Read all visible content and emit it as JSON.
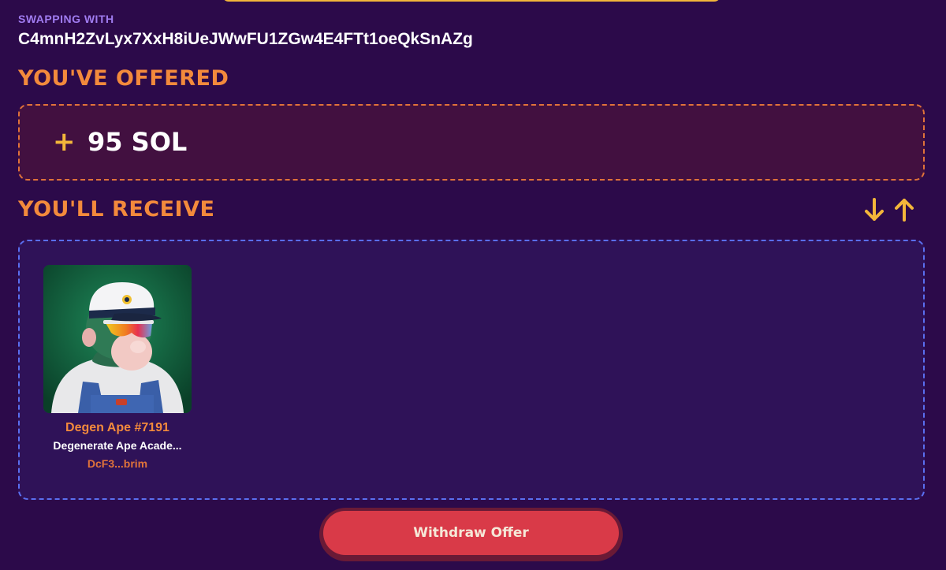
{
  "swap": {
    "label": "SWAPPING WITH",
    "address": "C4mnH2ZvLyx7XxH8iUeJWwFU1ZGw4E4FTt1oeQkSnAZg"
  },
  "offered": {
    "title": "YOU'VE OFFERED",
    "plus_icon": "+",
    "amount": "95 SOL"
  },
  "receive": {
    "title": "YOU'LL RECEIVE",
    "sort_icons": [
      "arrow-down-icon",
      "arrow-up-icon"
    ],
    "items": [
      {
        "name": "Degen Ape #7191",
        "collection": "Degenerate Ape Acade...",
        "owner": "DcF3...brim"
      }
    ]
  },
  "actions": {
    "withdraw_label": "Withdraw Offer"
  },
  "colors": {
    "background": "#2c0a4a",
    "accent_orange": "#f38a3c",
    "accent_yellow": "#f3b63a",
    "label_purple": "#a07cf0",
    "offer_box": "#421040",
    "receive_box": "#2f1258",
    "withdraw_button": "#d93a48"
  }
}
